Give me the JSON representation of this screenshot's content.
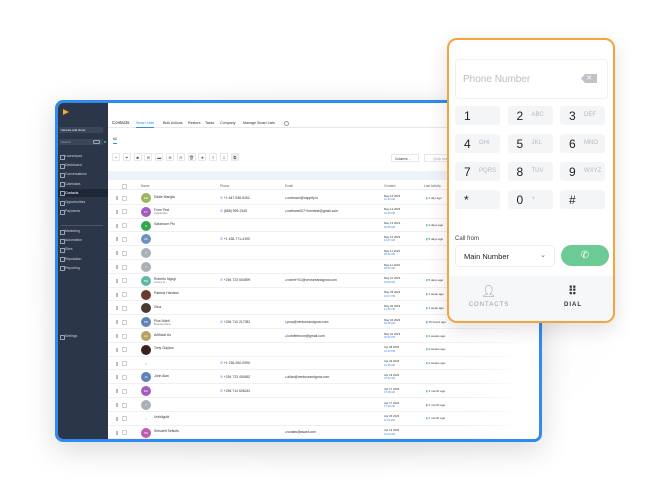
{
  "brand": {
    "logo_text": "VENTURE & GROW"
  },
  "sidebar": {
    "account": "Venture and Grow",
    "search": "Search",
    "items": [
      "Launchpad",
      "Dashboard",
      "Conversations",
      "Calendars",
      "Contacts",
      "Opportunities",
      "Payments"
    ],
    "items2": [
      "Marketing",
      "Automation",
      "Sites",
      "Reputation",
      "Reporting"
    ],
    "settings": "Settings",
    "active": "Contacts"
  },
  "tabs": {
    "title": "Contacts",
    "items": [
      "Smart Lists",
      "Bulk Actions",
      "Restore",
      "Tasks",
      "Company",
      "Manage Smart Lists"
    ],
    "active": "Smart Lists",
    "sub": "All"
  },
  "toolbar": {
    "icons": [
      "plus-icon",
      "filter-icon",
      "robot-icon",
      "message-icon",
      "email-icon",
      "tag-add-icon",
      "tag-remove-icon",
      "delete-icon",
      "star-icon",
      "export-icon",
      "import-icon",
      "merge-icon"
    ],
    "columns": "Columns",
    "quick_search": "Quick search",
    "total": "Total 83 records"
  },
  "table": {
    "headers": [
      "Name",
      "Phone",
      "Email",
      "Created",
      "Last Activity"
    ],
    "rows": [
      {
        "i": "EM",
        "c": "#9bb55a",
        "n": "Eddie Mangla",
        "o": "",
        "p": "+1 647-938-5262",
        "e": "outreach@cappify.io",
        "d": "May 16 2023",
        "t": "10:43 AM",
        "a": "1 day ago",
        "ab": false
      },
      {
        "i": "FT",
        "c": "#a35bc0",
        "n": "Form Test",
        "o": "Organization",
        "p": "(888) 999-2345",
        "e": "nathans007+formtest@gmail.com",
        "d": "May 14 2023",
        "t": "04:45 PM",
        "a": "",
        "ab": false
      },
      {
        "i": "S",
        "c": "#2fa84f",
        "n": "Safaricom Plc",
        "o": "",
        "p": "",
        "e": "",
        "d": "May 13 2023",
        "t": "06:38 AM",
        "a": "4 days ago",
        "ab": false
      },
      {
        "i": "CF",
        "c": "#6a93c0",
        "n": "",
        "o": "",
        "p": "+1 438-771-4190",
        "e": "",
        "d": "May 12 2023",
        "t": "10:07 AM",
        "a": "5 days ago",
        "ab": false
      },
      {
        "i": "?",
        "c": "#aab0b8",
        "n": "",
        "o": "",
        "p": "",
        "e": "",
        "d": "May 11 2023",
        "t": "08:24 AM",
        "a": "",
        "ab": false
      },
      {
        "i": "?",
        "c": "#aab0b8",
        "n": "",
        "o": "",
        "p": "",
        "e": "",
        "d": "May 11 2023",
        "t": "08:22 AM",
        "a": "",
        "ab": false
      },
      {
        "i": "RN",
        "c": "#5fb8a5",
        "n": "Roberto Ngugi",
        "o": "Venture 11",
        "p": "+254 723 504899",
        "e": "robert+01@ventureandgrow.com",
        "d": "May 10 2023",
        "t": "04:08 AM",
        "a": "5 days ago",
        "ab": false
      },
      {
        "i": "",
        "c": "#6b3a2a",
        "n": "Patricia Harrison",
        "o": "",
        "p": "",
        "e": "",
        "d": "May 09 2023",
        "t": "01:27 PM",
        "a": "1 week ago",
        "ab": false
      },
      {
        "i": "",
        "c": "#4a3a32",
        "n": "Gina",
        "o": "",
        "p": "",
        "e": "",
        "d": "May 06 2023",
        "t": "12:46 PM",
        "a": "1 week ago",
        "ab": false
      },
      {
        "i": "PN",
        "c": "#5f83b8",
        "n": "Pius Ndeti",
        "o": "Business Name",
        "p": "+254 710 217381",
        "e": "pius@ventureandgrow.com",
        "d": "May 04 2023",
        "t": "06:38 AM",
        "a": "16 hours ago",
        "ab": true
      },
      {
        "i": "AU",
        "c": "#b8a060",
        "n": "Artificial Us",
        "o": "",
        "p": "",
        "e": "kofofetecom@gmail.com",
        "d": "May 02 2023",
        "t": "02:33 PM",
        "a": "2 weeks ago",
        "ab": false
      },
      {
        "i": "",
        "c": "#3a2222",
        "n": "Tony Clayton",
        "o": "",
        "p": "",
        "e": "",
        "d": "Apr 28 2023",
        "t": "12:23 PM",
        "a": "2 weeks ago",
        "ab": false
      },
      {
        "i": "",
        "c": "#ffffff",
        "n": "",
        "o": "",
        "p": "+1 236-260-0990",
        "e": "",
        "d": "Apr 19 2023",
        "t": "10:36 AM",
        "a": "4 weeks ago",
        "ab": false
      },
      {
        "i": "JA",
        "c": "#5f83b8",
        "n": "John Alan",
        "o": "",
        "p": "+254 723 454562",
        "e": "allan@ventureandgrow.com",
        "d": "Apr 19 2023",
        "t": "07:33 AM",
        "a": "",
        "ab": false
      },
      {
        "i": "DK",
        "c": "#a55bc0",
        "n": "",
        "o": "",
        "p": "+254 714 606242",
        "e": "",
        "d": "Apr 17 2023",
        "t": "07:28 AM",
        "a": "1 month ago",
        "ab": false
      },
      {
        "i": "?",
        "c": "#aab0b8",
        "n": "",
        "o": "",
        "p": "",
        "e": "",
        "d": "Apr 17 2023",
        "t": "07:19 AM",
        "a": "1 month ago",
        "ab": true
      },
      {
        "i": "",
        "c": "#ffffff",
        "n": "Unfollguitt",
        "o": "",
        "p": "",
        "e": "",
        "d": "Apr 15 2023",
        "t": "11:32 PM",
        "a": "1 month ago",
        "ab": false
      },
      {
        "i": "SS",
        "c": "#c05bb0",
        "n": "Sefuaetf Sefsofs",
        "o": "",
        "p": "",
        "e": "sxafas@asasf.com",
        "d": "Apr 13 2023",
        "t": "10:23 AM",
        "a": "",
        "ab": false
      }
    ]
  },
  "dialer": {
    "placeholder": "Phone Number",
    "keys": [
      [
        "1",
        ""
      ],
      [
        "2",
        "ABC"
      ],
      [
        "3",
        "DEF"
      ],
      [
        "4",
        "GHI"
      ],
      [
        "5",
        "JKL"
      ],
      [
        "6",
        "MNO"
      ],
      [
        "7",
        "PQRS"
      ],
      [
        "8",
        "TUV"
      ],
      [
        "9",
        "WXYZ"
      ],
      [
        "*",
        ""
      ],
      [
        "0",
        "+"
      ],
      [
        "#",
        ""
      ]
    ],
    "call_from_label": "Call from",
    "call_from_value": "Main Number",
    "nav": [
      {
        "label": "CONTACTS",
        "icon": "person-icon"
      },
      {
        "label": "DIAL",
        "icon": "dialpad-icon"
      }
    ],
    "active": "DIAL"
  },
  "colors": {
    "frame": "#2f8bf0",
    "dialer_border": "#f5a33c",
    "call_button": "#6ccb95",
    "sidebar": "#2b3648"
  }
}
